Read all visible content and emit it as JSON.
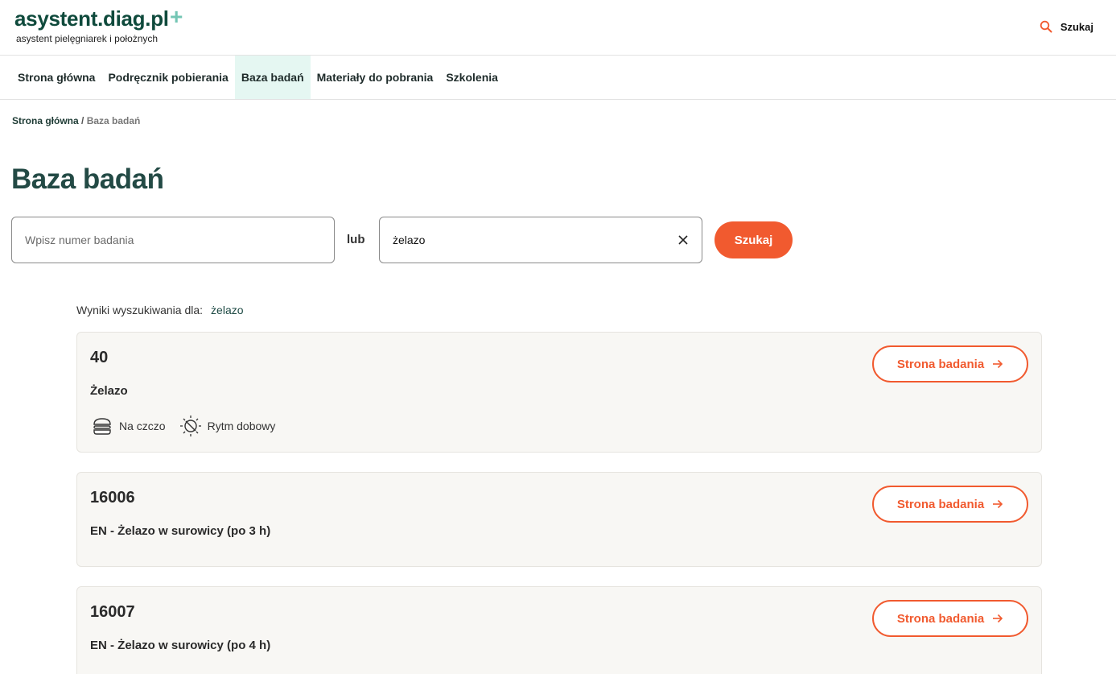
{
  "header": {
    "logo": "asystent.diag.pl",
    "logo_plus": "+",
    "tagline": "asystent pielęgniarek i położnych",
    "search_label": "Szukaj"
  },
  "nav": {
    "items": [
      {
        "label": "Strona główna"
      },
      {
        "label": "Podręcznik pobierania"
      },
      {
        "label": "Baza badań",
        "active": true
      },
      {
        "label": "Materiały do pobrania"
      },
      {
        "label": "Szkolenia"
      }
    ]
  },
  "breadcrumb": {
    "home": "Strona główna",
    "separator": " / ",
    "current": "Baza badań"
  },
  "page": {
    "title": "Baza badań"
  },
  "search": {
    "number_placeholder": "Wpisz numer badania",
    "or_label": "lub",
    "text_value": "żelazo",
    "button_label": "Szukaj"
  },
  "results": {
    "label": "Wyniki wyszukiwania dla:",
    "query": "żelazo",
    "items": [
      {
        "number": "40",
        "name": "Żelazo",
        "button_label": "Strona badania",
        "tags": [
          {
            "icon": "burger-icon",
            "label": "Na czczo"
          },
          {
            "icon": "sun-clock-icon",
            "label": "Rytm dobowy"
          }
        ]
      },
      {
        "number": "16006",
        "name": "EN - Żelazo w surowicy (po 3 h)",
        "button_label": "Strona badania",
        "tags": []
      },
      {
        "number": "16007",
        "name": "EN - Żelazo w surowicy (po 4 h)",
        "button_label": "Strona badania",
        "tags": []
      }
    ]
  },
  "colors": {
    "accent": "#f15a2f",
    "brand": "#0f4a3c",
    "brand_plus": "#74c6b4",
    "nav_active_bg": "#e5f7f2",
    "card_bg": "#f8f7f4"
  }
}
